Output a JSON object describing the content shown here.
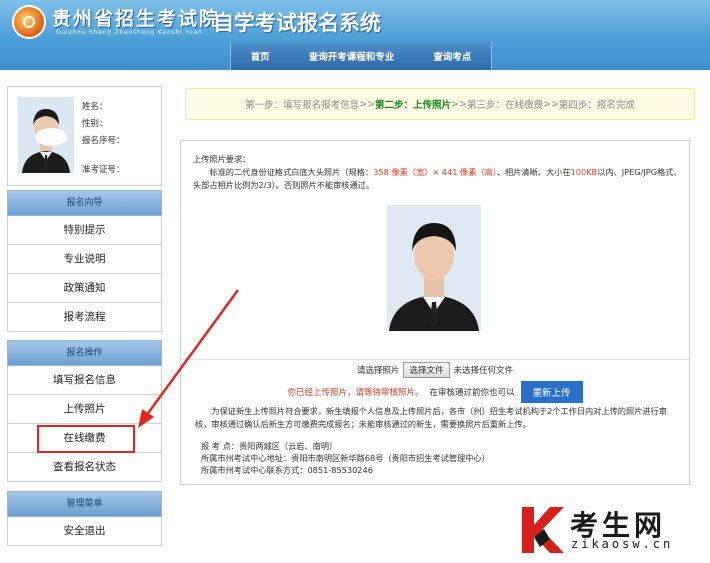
{
  "header": {
    "logo_name": "贵州省招生考试院",
    "logo_pinyin": "Guizhou Sheng Zhaosheng Kaoshi Yuan",
    "system_title": "自学考试报名系统",
    "nav": [
      "首页",
      "查询开考课程和专业",
      "查询考点"
    ]
  },
  "profile": {
    "name_label": "姓名：",
    "gender_label": "性别：",
    "reg_no_label": "报名序号：",
    "admission_no_label": "准考证号："
  },
  "sidebar": {
    "guide_title": "报名向导",
    "guide_items": [
      "特别提示",
      "专业说明",
      "政策通知",
      "报考流程"
    ],
    "ops_title": "报名操作",
    "ops_items": [
      "填写报名信息",
      "上传照片",
      "在线缴费",
      "查看报名状态"
    ],
    "manage_title": "管理菜单",
    "manage_items": [
      "安全退出"
    ]
  },
  "steps": {
    "s1": "第一步：填写报名报考信息",
    "sep": " >> ",
    "s2": "第二步：上传照片",
    "s3": "第三步：在线缴费",
    "s4": "第四步：报名完成"
  },
  "upload": {
    "req_title": "上传照片要求：",
    "req_p1": "标准的二代身份证格式白底大头照片（规格：",
    "req_size": "358 像素（宽）× 441 像素（高）",
    "req_p2": "、相片清晰、大小在",
    "req_kb": "100KB",
    "req_p3": "以内、JPEG/JPG格式、头部占相片比例为2/3）。否则照片不能审核通过。",
    "choose_label": "请选择照片",
    "choose_btn": "选择文件",
    "no_file": "未选择任何文件",
    "uploaded_warn": "你已经上传照片，请等待审核照片。",
    "before_audit": "在审核通过前你也可以",
    "reupload_btn": "重新上传",
    "note": "为保证新生上传照片符合要求，新生填报个人信息及上传照片后，各市（州）招生考试机构于2个工作日内对上传的照片进行审核，审核通过确认后新生方可缴费完成报名；未能审核通过的新生，需要换照片后重新上传。",
    "site": "报  考  点：贵阳两城区（云岩、南明）",
    "center_addr": "所属市州考试中心地址：贵阳市南明区新华路68号（贵阳市招生考试管理中心）",
    "center_phone": "所属市州考试中心联系方式：0851-85530246"
  },
  "watermark": {
    "brand": "考生网",
    "url": "zikaosw.cn"
  },
  "colors": {
    "header_blue": "#4d9fd8",
    "nav_blue": "#2c6aa9",
    "current_step": "#1a8a1a",
    "highlight_red": "#e52620",
    "button_blue": "#2a70c8"
  }
}
